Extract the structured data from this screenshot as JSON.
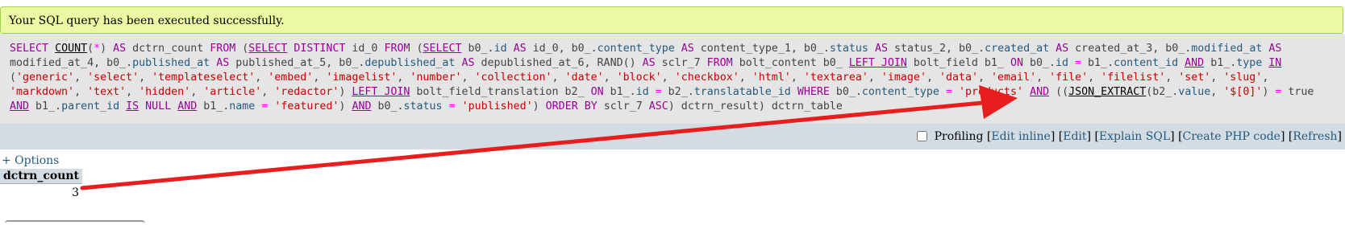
{
  "message": {
    "success": "Your SQL query has been executed successfully."
  },
  "sql": {
    "tokens": [
      {
        "t": "SELECT",
        "c": "kw"
      },
      {
        "t": " ",
        "c": "plain"
      },
      {
        "t": "COUNT",
        "c": "fn"
      },
      {
        "t": "(",
        "c": "plain"
      },
      {
        "t": "*",
        "c": "op"
      },
      {
        "t": ") ",
        "c": "plain"
      },
      {
        "t": "AS",
        "c": "kw"
      },
      {
        "t": " dctrn_count ",
        "c": "plain"
      },
      {
        "t": "FROM",
        "c": "kw"
      },
      {
        "t": " (",
        "c": "plain"
      },
      {
        "t": "SELECT",
        "c": "kwu"
      },
      {
        "t": " ",
        "c": "plain"
      },
      {
        "t": "DISTINCT",
        "c": "kw"
      },
      {
        "t": " id_0 ",
        "c": "plain"
      },
      {
        "t": "FROM",
        "c": "kw"
      },
      {
        "t": " (",
        "c": "plain"
      },
      {
        "t": "SELECT",
        "c": "kwu"
      },
      {
        "t": " b0_.",
        "c": "plain"
      },
      {
        "t": "id",
        "c": "col"
      },
      {
        "t": " ",
        "c": "plain"
      },
      {
        "t": "AS",
        "c": "kw"
      },
      {
        "t": " id_0, b0_.",
        "c": "plain"
      },
      {
        "t": "content_type",
        "c": "col"
      },
      {
        "t": " ",
        "c": "plain"
      },
      {
        "t": "AS",
        "c": "kw"
      },
      {
        "t": " content_type_1, b0_.",
        "c": "plain"
      },
      {
        "t": "status",
        "c": "col"
      },
      {
        "t": " ",
        "c": "plain"
      },
      {
        "t": "AS",
        "c": "kw"
      },
      {
        "t": " status_2, b0_.",
        "c": "plain"
      },
      {
        "t": "created_at",
        "c": "col"
      },
      {
        "t": " ",
        "c": "plain"
      },
      {
        "t": "AS",
        "c": "kw"
      },
      {
        "t": " created_at_3, b0_.",
        "c": "plain"
      },
      {
        "t": "modified_at",
        "c": "col"
      },
      {
        "t": " ",
        "c": "plain"
      },
      {
        "t": "AS",
        "c": "kw"
      },
      {
        "t": " modified_at_4, b0_.",
        "c": "plain"
      },
      {
        "t": "published_at",
        "c": "col"
      },
      {
        "t": " ",
        "c": "plain"
      },
      {
        "t": "AS",
        "c": "kw"
      },
      {
        "t": " published_at_5, b0_.",
        "c": "plain"
      },
      {
        "t": "depublished_at",
        "c": "col"
      },
      {
        "t": " ",
        "c": "plain"
      },
      {
        "t": "AS",
        "c": "kw"
      },
      {
        "t": " depublished_at_6, RAND() ",
        "c": "plain"
      },
      {
        "t": "AS",
        "c": "kw"
      },
      {
        "t": " sclr_7 ",
        "c": "plain"
      },
      {
        "t": "FROM",
        "c": "kw"
      },
      {
        "t": " bolt_content b0_ ",
        "c": "plain"
      },
      {
        "t": "LEFT JOIN",
        "c": "kwu"
      },
      {
        "t": " bolt_field b1_ ",
        "c": "plain"
      },
      {
        "t": "ON",
        "c": "kw"
      },
      {
        "t": " b0_.",
        "c": "plain"
      },
      {
        "t": "id",
        "c": "col"
      },
      {
        "t": " ",
        "c": "plain"
      },
      {
        "t": "=",
        "c": "op"
      },
      {
        "t": " b1_.",
        "c": "plain"
      },
      {
        "t": "content_id",
        "c": "col"
      },
      {
        "t": " ",
        "c": "plain"
      },
      {
        "t": "AND",
        "c": "kwu"
      },
      {
        "t": " b1_.",
        "c": "plain"
      },
      {
        "t": "type",
        "c": "col"
      },
      {
        "t": " ",
        "c": "plain"
      },
      {
        "t": "IN",
        "c": "kwu"
      },
      {
        "t": " (",
        "c": "plain"
      },
      {
        "t": "'generic'",
        "c": "str"
      },
      {
        "t": ", ",
        "c": "plain"
      },
      {
        "t": "'select'",
        "c": "str"
      },
      {
        "t": ", ",
        "c": "plain"
      },
      {
        "t": "'templateselect'",
        "c": "str"
      },
      {
        "t": ", ",
        "c": "plain"
      },
      {
        "t": "'embed'",
        "c": "str"
      },
      {
        "t": ", ",
        "c": "plain"
      },
      {
        "t": "'imagelist'",
        "c": "str"
      },
      {
        "t": ", ",
        "c": "plain"
      },
      {
        "t": "'number'",
        "c": "str"
      },
      {
        "t": ", ",
        "c": "plain"
      },
      {
        "t": "'collection'",
        "c": "str"
      },
      {
        "t": ", ",
        "c": "plain"
      },
      {
        "t": "'date'",
        "c": "str"
      },
      {
        "t": ", ",
        "c": "plain"
      },
      {
        "t": "'block'",
        "c": "str"
      },
      {
        "t": ", ",
        "c": "plain"
      },
      {
        "t": "'checkbox'",
        "c": "str"
      },
      {
        "t": ", ",
        "c": "plain"
      },
      {
        "t": "'html'",
        "c": "str"
      },
      {
        "t": ", ",
        "c": "plain"
      },
      {
        "t": "'textarea'",
        "c": "str"
      },
      {
        "t": ", ",
        "c": "plain"
      },
      {
        "t": "'image'",
        "c": "str"
      },
      {
        "t": ", ",
        "c": "plain"
      },
      {
        "t": "'data'",
        "c": "str"
      },
      {
        "t": ", ",
        "c": "plain"
      },
      {
        "t": "'email'",
        "c": "str"
      },
      {
        "t": ", ",
        "c": "plain"
      },
      {
        "t": "'file'",
        "c": "str"
      },
      {
        "t": ", ",
        "c": "plain"
      },
      {
        "t": "'filelist'",
        "c": "str"
      },
      {
        "t": ", ",
        "c": "plain"
      },
      {
        "t": "'set'",
        "c": "str"
      },
      {
        "t": ", ",
        "c": "plain"
      },
      {
        "t": "'slug'",
        "c": "str"
      },
      {
        "t": ", ",
        "c": "plain"
      },
      {
        "t": "'markdown'",
        "c": "str"
      },
      {
        "t": ", ",
        "c": "plain"
      },
      {
        "t": "'text'",
        "c": "str"
      },
      {
        "t": ", ",
        "c": "plain"
      },
      {
        "t": "'hidden'",
        "c": "str"
      },
      {
        "t": ", ",
        "c": "plain"
      },
      {
        "t": "'article'",
        "c": "str"
      },
      {
        "t": ", ",
        "c": "plain"
      },
      {
        "t": "'redactor'",
        "c": "str"
      },
      {
        "t": ") ",
        "c": "plain"
      },
      {
        "t": "LEFT JOIN",
        "c": "kwu"
      },
      {
        "t": " bolt_field_translation b2_ ",
        "c": "plain"
      },
      {
        "t": "ON",
        "c": "kw"
      },
      {
        "t": " b1_.",
        "c": "plain"
      },
      {
        "t": "id",
        "c": "col"
      },
      {
        "t": " ",
        "c": "plain"
      },
      {
        "t": "=",
        "c": "op"
      },
      {
        "t": " b2_.",
        "c": "plain"
      },
      {
        "t": "translatable_id",
        "c": "col"
      },
      {
        "t": " ",
        "c": "plain"
      },
      {
        "t": "WHERE",
        "c": "kw"
      },
      {
        "t": " b0_.",
        "c": "plain"
      },
      {
        "t": "content_type",
        "c": "col"
      },
      {
        "t": " ",
        "c": "plain"
      },
      {
        "t": "=",
        "c": "op"
      },
      {
        "t": " ",
        "c": "plain"
      },
      {
        "t": "'products'",
        "c": "str"
      },
      {
        "t": " ",
        "c": "plain"
      },
      {
        "t": "AND",
        "c": "kwu"
      },
      {
        "t": " ((",
        "c": "plain"
      },
      {
        "t": "JSON_EXTRACT",
        "c": "fn"
      },
      {
        "t": "(b2_.",
        "c": "plain"
      },
      {
        "t": "value",
        "c": "col"
      },
      {
        "t": ", ",
        "c": "plain"
      },
      {
        "t": "'$[0]'",
        "c": "str"
      },
      {
        "t": ") ",
        "c": "plain"
      },
      {
        "t": "=",
        "c": "op"
      },
      {
        "t": " true ",
        "c": "plain"
      },
      {
        "t": "AND",
        "c": "kwu"
      },
      {
        "t": " b1_.",
        "c": "plain"
      },
      {
        "t": "parent_id",
        "c": "col"
      },
      {
        "t": " ",
        "c": "plain"
      },
      {
        "t": "IS",
        "c": "kwu"
      },
      {
        "t": " ",
        "c": "plain"
      },
      {
        "t": "NULL",
        "c": "kw"
      },
      {
        "t": " ",
        "c": "plain"
      },
      {
        "t": "AND",
        "c": "kwu"
      },
      {
        "t": " b1_.",
        "c": "plain"
      },
      {
        "t": "name",
        "c": "col"
      },
      {
        "t": " ",
        "c": "plain"
      },
      {
        "t": "=",
        "c": "op"
      },
      {
        "t": " ",
        "c": "plain"
      },
      {
        "t": "'featured'",
        "c": "str"
      },
      {
        "t": ") ",
        "c": "plain"
      },
      {
        "t": "AND",
        "c": "kwu"
      },
      {
        "t": " b0_.",
        "c": "plain"
      },
      {
        "t": "status",
        "c": "col"
      },
      {
        "t": " ",
        "c": "plain"
      },
      {
        "t": "=",
        "c": "op"
      },
      {
        "t": " ",
        "c": "plain"
      },
      {
        "t": "'published'",
        "c": "str"
      },
      {
        "t": ") ",
        "c": "plain"
      },
      {
        "t": "ORDER BY",
        "c": "kw"
      },
      {
        "t": " sclr_7 ",
        "c": "plain"
      },
      {
        "t": "ASC",
        "c": "kw"
      },
      {
        "t": ") dctrn_result) dctrn_table",
        "c": "plain"
      }
    ]
  },
  "toolbar": {
    "profiling_label": "Profiling",
    "edit_inline": "Edit inline",
    "edit": "Edit",
    "explain_sql": "Explain SQL",
    "create_php": "Create PHP code",
    "refresh": "Refresh"
  },
  "options": {
    "label": "+ Options"
  },
  "result": {
    "header": "dctrn_count",
    "value": "3"
  },
  "colors": {
    "success_bg": "#ebf8a4",
    "success_border": "#a2d246",
    "sql_bg": "#e5e5e5",
    "toolbar_bg": "#d3dce3",
    "link": "#235a81",
    "arrow": "#e81d1d"
  }
}
